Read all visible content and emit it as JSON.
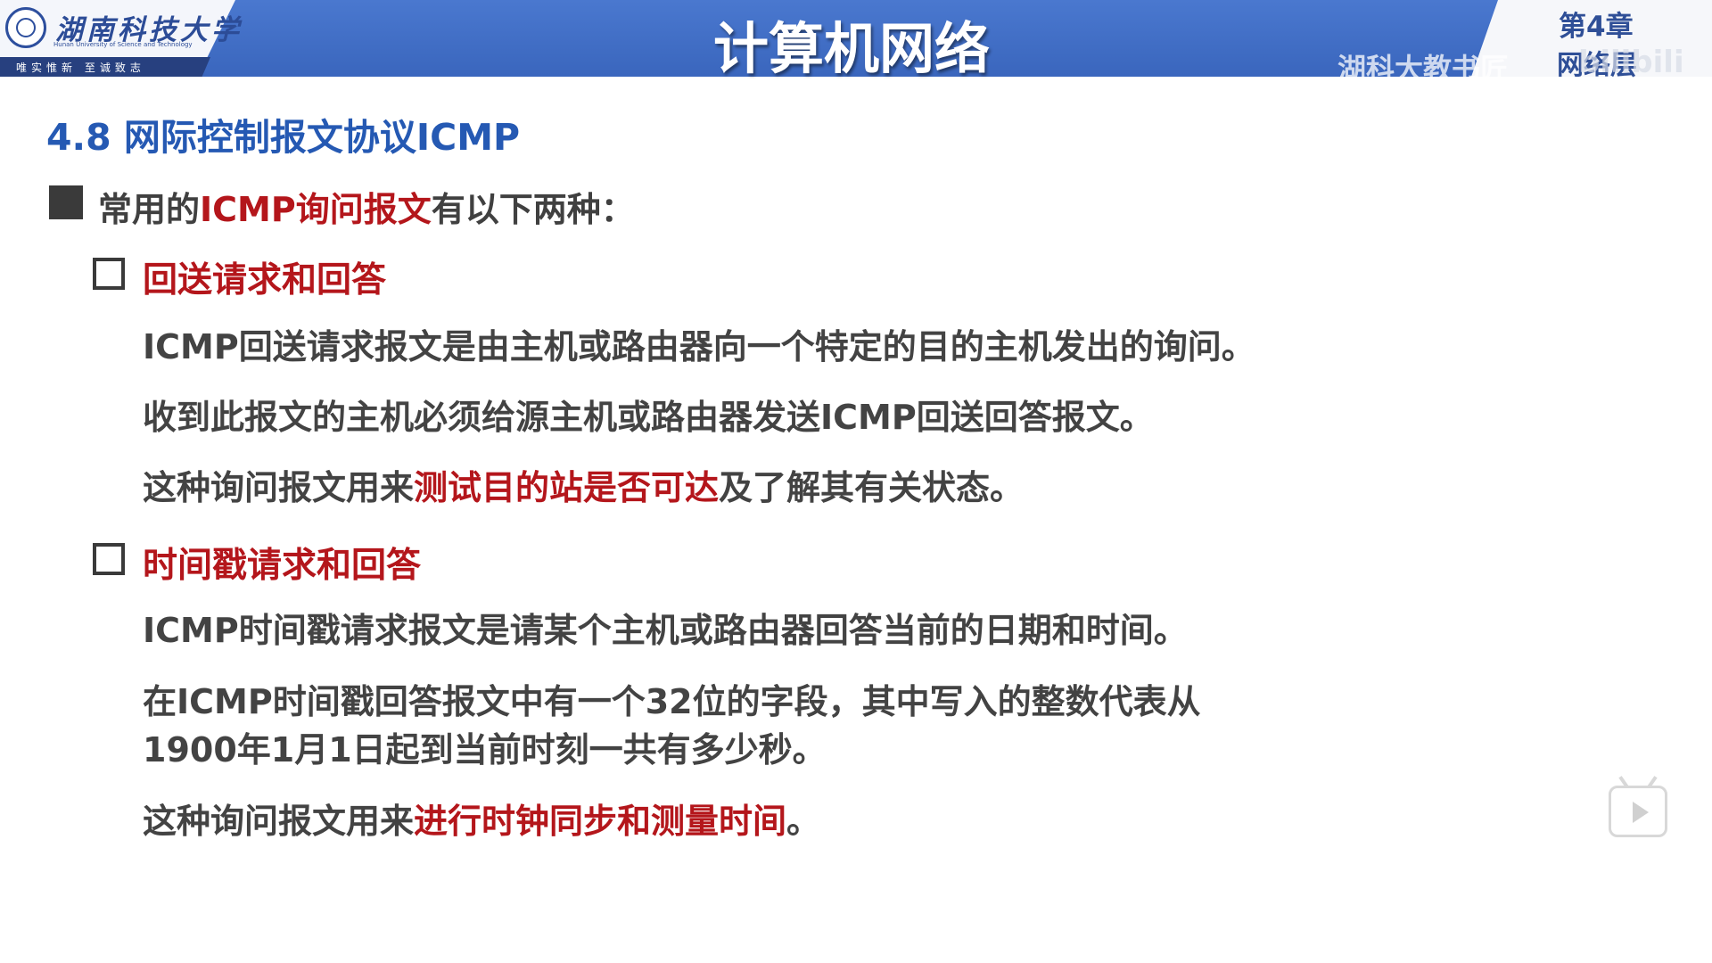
{
  "header": {
    "logo": {
      "name_cn": "湖南科技大学",
      "name_en": "Hunan University of Science and Technology",
      "motto": "唯实惟新  至诚致志"
    },
    "course_title": "计算机网络",
    "chapter_number": "第4章",
    "chapter_name": "网络层",
    "watermark": "湖科大教书匠",
    "platform_logo": "bilibili"
  },
  "content": {
    "section_title": "4.8 网际控制报文协议ICMP",
    "intro": {
      "prefix": "常用的",
      "highlight": "ICMP询问报文",
      "suffix": "有以下两种："
    },
    "items": [
      {
        "title": "回送请求和回答",
        "paragraphs": [
          {
            "text": "ICMP回送请求报文是由主机或路由器向一个特定的目的主机发出的询问。"
          },
          {
            "text": "收到此报文的主机必须给源主机或路由器发送ICMP回送回答报文。"
          },
          {
            "prefix": "这种询问报文用来",
            "highlight": "测试目的站是否可达",
            "suffix": "及了解其有关状态。"
          }
        ]
      },
      {
        "title": "时间戳请求和回答",
        "paragraphs": [
          {
            "text": "ICMP时间戳请求报文是请某个主机或路由器回答当前的日期和时间。"
          },
          {
            "line1": "在ICMP时间戳回答报文中有一个32位的字段，其中写入的整数代表从",
            "line2": "1900年1月1日起到当前时刻一共有多少秒。"
          },
          {
            "prefix": "这种询问报文用来",
            "highlight": "进行时钟同步和测量时间",
            "suffix": "。"
          }
        ]
      }
    ]
  },
  "controls": {
    "play_icon": "tv-play-icon"
  },
  "colors": {
    "header_blue": "#3a66bd",
    "title_blue": "#2559b3",
    "highlight_red": "#b4161b",
    "body_text": "#434343"
  }
}
